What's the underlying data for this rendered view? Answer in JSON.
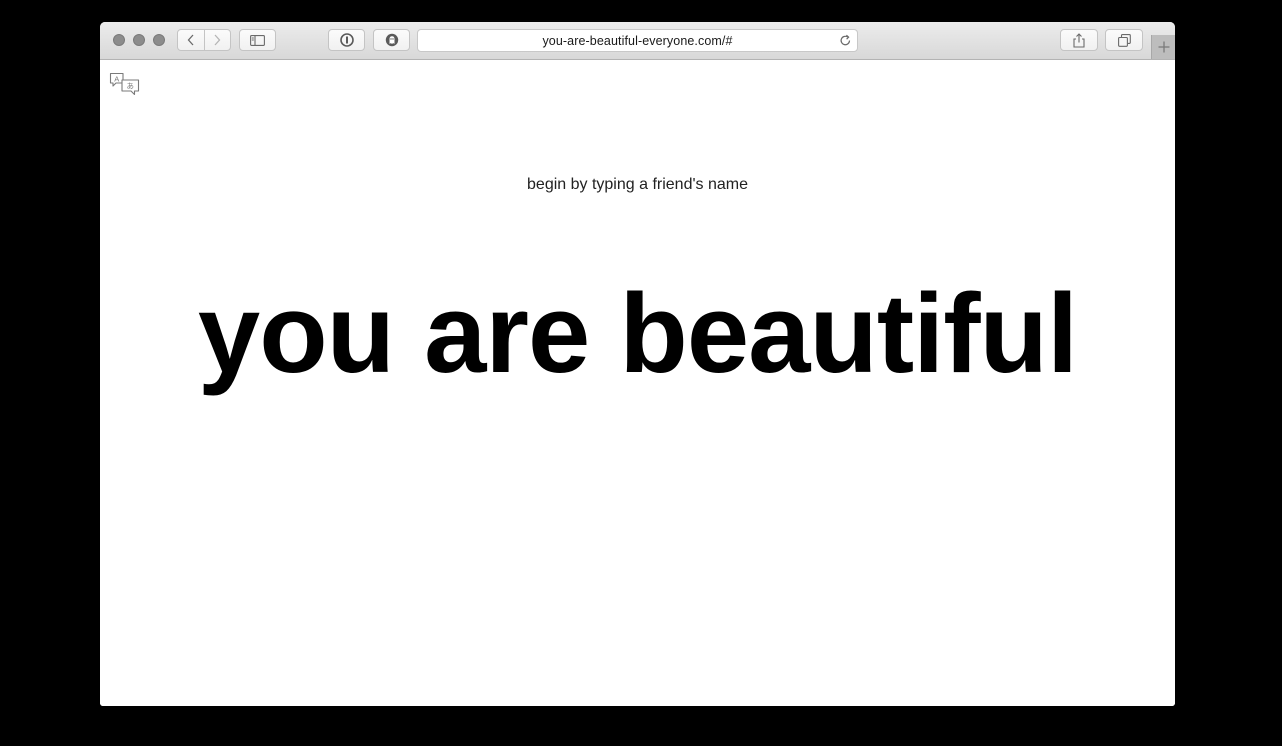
{
  "browser": {
    "url": "you-are-beautiful-everyone.com/#",
    "icons": {
      "back": "chevron-left-icon",
      "forward": "chevron-right-icon",
      "sidebar": "sidebar-icon",
      "password": "password-manager-icon",
      "extension": "ghostery-icon",
      "reload": "reload-icon",
      "share": "share-icon",
      "tabs": "tab-overview-icon",
      "new_tab": "plus-icon"
    }
  },
  "page": {
    "translate_icon": "translate-icon",
    "prompt": "begin by typing a friend's name",
    "headline": "you are beautiful"
  },
  "colors": {
    "background": "#000000",
    "page": "#ffffff",
    "headline": "#000000"
  }
}
